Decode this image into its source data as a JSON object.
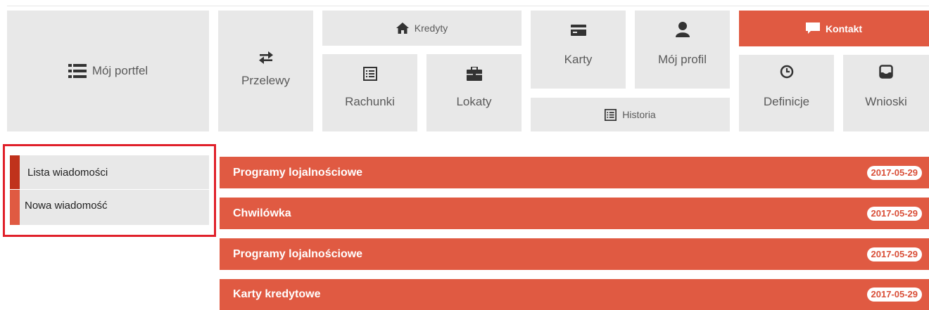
{
  "nav": {
    "portfel": "Mój portfel",
    "przelewy": "Przelewy",
    "kredyty": "Kredyty",
    "rachunki": "Rachunki",
    "lokaty": "Lokaty",
    "karty": "Karty",
    "profil": "Mój profil",
    "historia": "Historia",
    "kontakt": "Kontakt",
    "definicje": "Definicje",
    "wnioski": "Wnioski"
  },
  "sidebar": {
    "items": [
      {
        "label": "Lista wiadomości"
      },
      {
        "label": "Nowa wiadomość"
      }
    ]
  },
  "messages": [
    {
      "title": "Programy lojalnościowe",
      "date": "2017-05-29"
    },
    {
      "title": "Chwilówka",
      "date": "2017-05-29"
    },
    {
      "title": "Programy lojalnościowe",
      "date": "2017-05-29"
    },
    {
      "title": "Karty kredytowe",
      "date": "2017-05-29"
    }
  ],
  "colors": {
    "accent": "#e05a42",
    "tile": "#e8e8e8",
    "active_bar": "#c0321c",
    "highlight_frame": "#e0202a"
  }
}
